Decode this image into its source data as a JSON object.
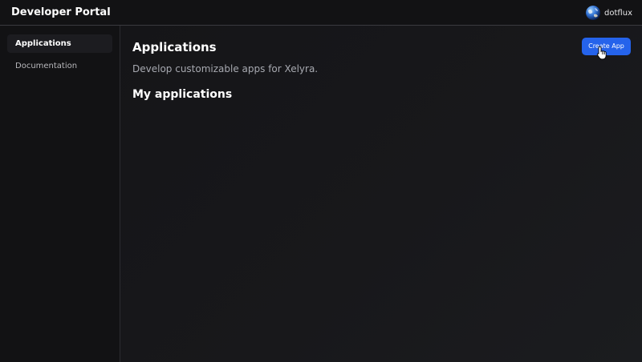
{
  "header": {
    "title": "Developer Portal",
    "user": {
      "name": "dotflux",
      "avatar_icon": "globe-avatar-icon"
    }
  },
  "sidebar": {
    "items": [
      {
        "label": "Applications",
        "active": true
      },
      {
        "label": "Documentation",
        "active": false
      }
    ]
  },
  "main": {
    "title": "Applications",
    "subtitle": "Develop customizable apps for Xelyra.",
    "section_title": "My applications",
    "create_button_label": "Create App"
  },
  "colors": {
    "background": "#121214",
    "accent": "#2563eb",
    "subtitle_text": "#a7a9b0",
    "border": "#3a3a3f"
  }
}
